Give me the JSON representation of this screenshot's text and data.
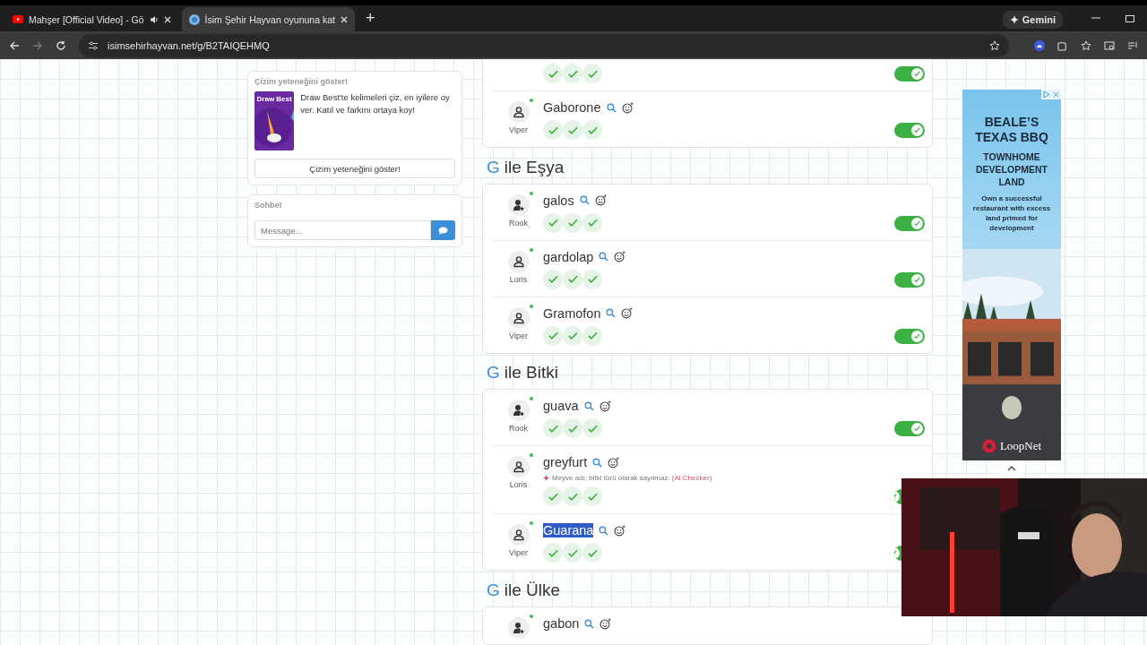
{
  "browser": {
    "tabs": [
      {
        "title": "Mahşer [Official Video] - Gö",
        "kind": "video",
        "audio": true,
        "selected": false
      },
      {
        "title": "İsim Şehir Hayvan oyununa kat",
        "kind": "site",
        "audio": false,
        "selected": true
      }
    ],
    "new_tab": "+",
    "gemini": "Gemini",
    "url": "isimsehirhayvan.net/g/B2TAIQEHMQ"
  },
  "promo": {
    "title": "Çizim yeteneğini göster!",
    "image_title": "Draw Best",
    "text": "Draw Best'te kelimeleri çiz, en iyilere oy ver. Katıl ve farkını ortaya koy!",
    "button": "Çizim yeteneğini göster!"
  },
  "chat": {
    "title": "Sohbet",
    "placeholder": "Message..."
  },
  "categories": [
    {
      "answers": [
        {
          "votes": [
            true,
            true,
            true
          ],
          "on": true
        },
        {
          "word": "Gaborone",
          "player": "Viper",
          "host": false,
          "highlighted": false,
          "votes": [
            true,
            true,
            true
          ],
          "on": true
        }
      ]
    },
    {
      "letter": "G",
      "name": "ile Eşya",
      "answers": [
        {
          "word": "galos",
          "player": "Rook",
          "host": true,
          "highlighted": false,
          "votes": [
            true,
            true,
            true
          ],
          "on": true
        },
        {
          "word": "gardolap",
          "player": "Loris",
          "host": false,
          "highlighted": false,
          "votes": [
            true,
            true,
            true
          ],
          "on": true
        },
        {
          "word": "Gramofon",
          "player": "Viper",
          "host": false,
          "highlighted": false,
          "votes": [
            true,
            true,
            true
          ],
          "on": true
        }
      ]
    },
    {
      "letter": "G",
      "name": "ile Bitki",
      "answers": [
        {
          "word": "guava",
          "player": "Rook",
          "host": true,
          "highlighted": false,
          "votes": [
            true,
            true,
            true
          ],
          "on": true
        },
        {
          "word": "greyfurt",
          "player": "Loris",
          "host": false,
          "highlighted": false,
          "note": "Meyve adı; bitki türü olarak sayılmaz.",
          "note_source": "(Ai Checker)",
          "votes": [
            true,
            true,
            true
          ],
          "on": true
        },
        {
          "word": "Guarana",
          "player": "Viper",
          "host": false,
          "highlighted": true,
          "votes": [
            true,
            true,
            true
          ],
          "on": true
        }
      ]
    },
    {
      "letter": "G",
      "name": "ile Ülke",
      "answers": [
        {
          "word": "gabon",
          "host": true,
          "highlighted": false
        }
      ]
    }
  ],
  "ad": {
    "headline": "BEALE’S TEXAS BBQ",
    "subhead": "TOWNHOME DEVELOPMENT LAND",
    "body": "Own a successful restaurant with excess land primed for development",
    "brand": "LoopNet"
  }
}
